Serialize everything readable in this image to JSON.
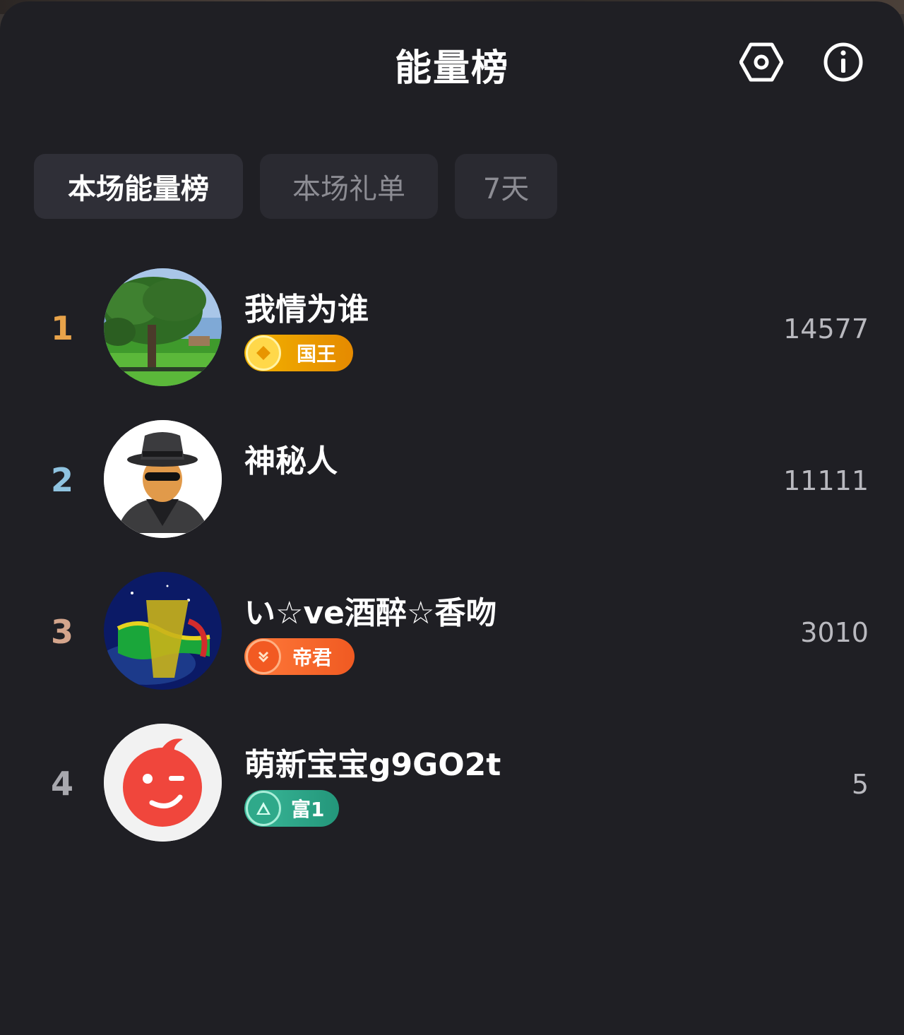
{
  "title": "能量榜",
  "icons": {
    "settings": "hexagon-settings-icon",
    "info": "info-icon"
  },
  "tabs": [
    {
      "label": "本场能量榜",
      "active": true
    },
    {
      "label": "本场礼单",
      "active": false
    },
    {
      "label": "7天",
      "active": false
    }
  ],
  "colors": {
    "rank1": "#e8a34a",
    "rank2": "#8fc3e0",
    "rank3": "#d4a58c",
    "rank4": "#a8a8ae"
  },
  "leaderboard": [
    {
      "rank": "1",
      "name": "我情为谁",
      "score": "14577",
      "badge": "国王",
      "avatar": "tree-landscape-avatar"
    },
    {
      "rank": "2",
      "name": "神秘人",
      "score": "11111",
      "badge": "",
      "avatar": "mystery-man-avatar"
    },
    {
      "rank": "3",
      "name": "い☆ve酒醉☆香吻",
      "score": "3010",
      "badge": "帝君",
      "avatar": "kiss-calligraphy-avatar"
    },
    {
      "rank": "4",
      "name": "萌新宝宝g9GO2t",
      "score": "5",
      "badge": "富1",
      "avatar": "red-wink-face-avatar"
    }
  ]
}
